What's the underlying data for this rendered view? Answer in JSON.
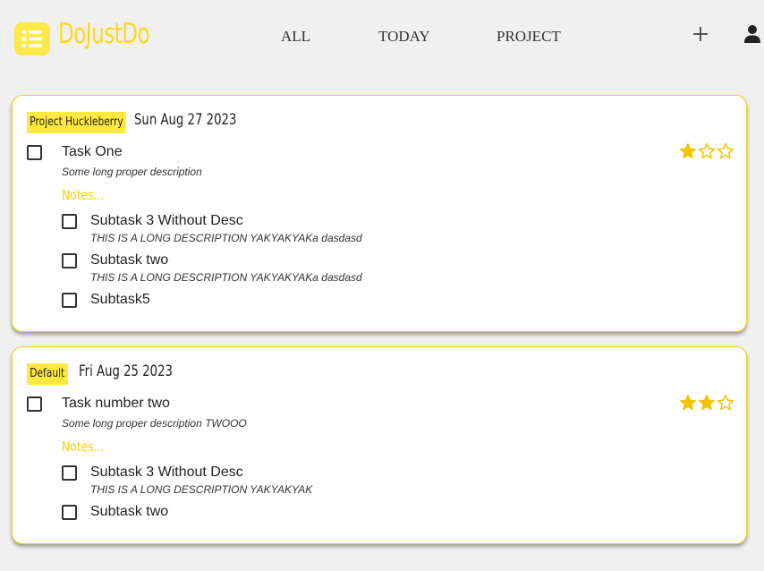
{
  "app": {
    "brand": "DoJustDo",
    "accent": "#ffd81c"
  },
  "nav": {
    "all": "ALL",
    "today": "TODAY",
    "project": "PROJECT"
  },
  "icons": {
    "logo": "list-icon",
    "add": "plus-icon",
    "user": "user-icon",
    "star": "star-icon"
  },
  "tasks": [
    {
      "project": "Project Huckleberry",
      "date": "Sun Aug 27 2023",
      "title": "Task One",
      "description": "Some long proper description",
      "notes_label": "Notes...",
      "rating": 1,
      "rating_max": 3,
      "subtasks": [
        {
          "title": "Subtask 3 Without Desc",
          "description": "THIS IS A LONG DESCRIPTION YAKYAKYAKa dasdasd"
        },
        {
          "title": "Subtask two",
          "description": "THIS IS A LONG DESCRIPTION YAKYAKYAKa dasdasd"
        },
        {
          "title": "Subtask5",
          "description": ""
        }
      ]
    },
    {
      "project": "Default",
      "date": "Fri Aug 25 2023",
      "title": "Task number two",
      "description": "Some long proper description TWOOO",
      "notes_label": "Notes...",
      "rating": 2,
      "rating_max": 3,
      "subtasks": [
        {
          "title": "Subtask 3 Without Desc",
          "description": "THIS IS A LONG DESCRIPTION YAKYAKYAK"
        },
        {
          "title": "Subtask two",
          "description": ""
        }
      ]
    }
  ]
}
